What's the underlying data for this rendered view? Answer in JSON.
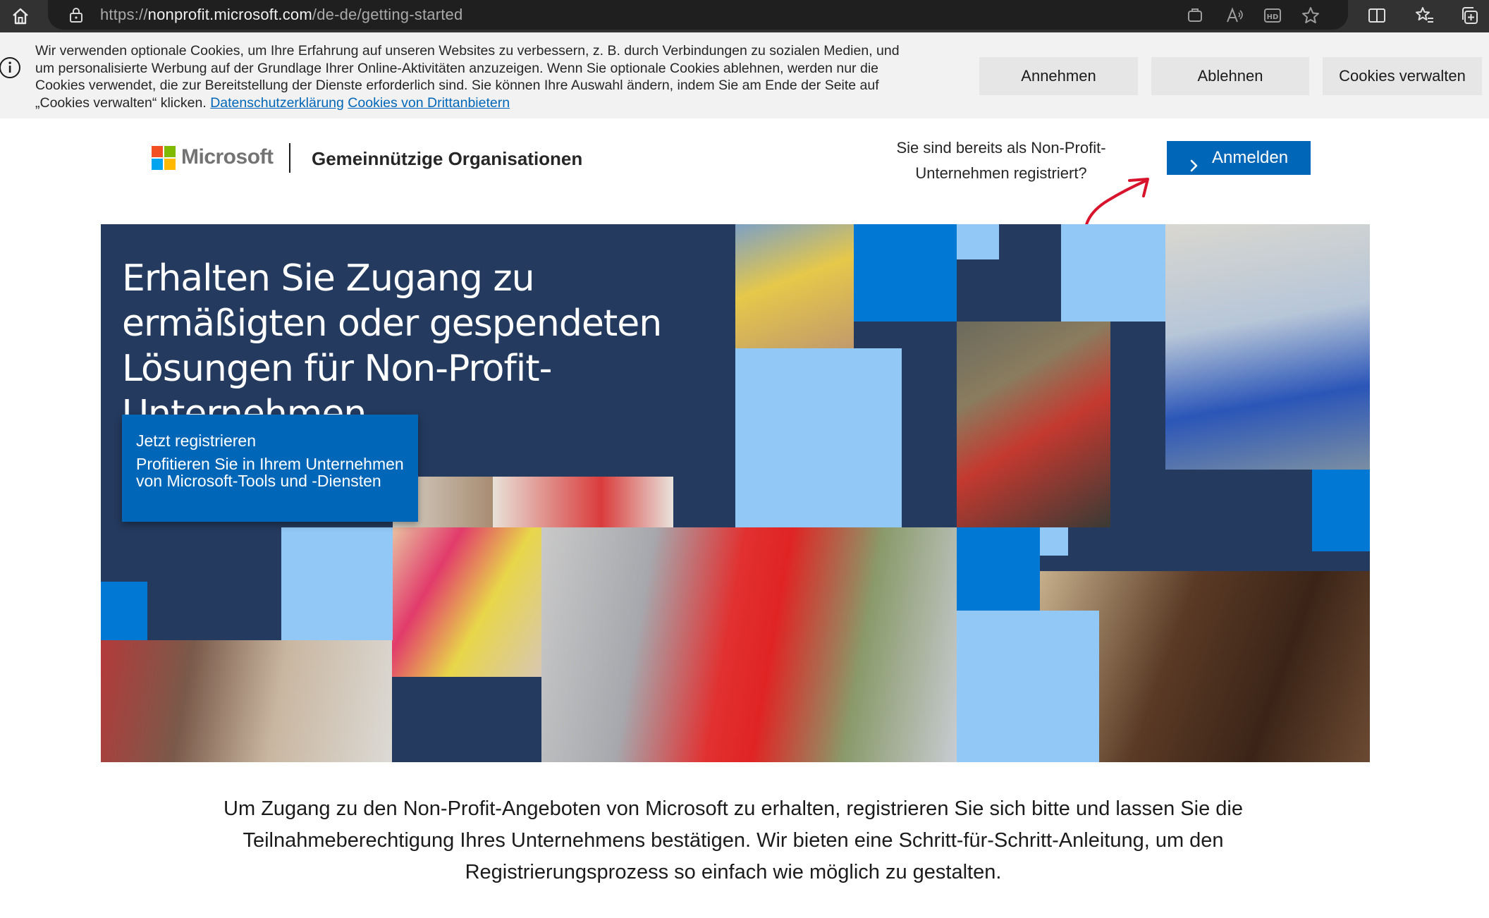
{
  "browser": {
    "url_scheme": "https://",
    "url_host": "nonprofit.microsoft.com",
    "url_path": "/de-de/getting-started",
    "icons": [
      "home-icon",
      "lock-icon",
      "extensions-icon",
      "read-aloud-icon",
      "hd-icon",
      "favorite-star-icon",
      "split-screen-icon",
      "favorites-icon",
      "collections-icon"
    ]
  },
  "cookie_banner": {
    "text": "Wir verwenden optionale Cookies, um Ihre Erfahrung auf unseren Websites zu verbessern, z. B. durch Verbindungen zu sozialen Medien, und um personalisierte Werbung auf der Grundlage Ihrer Online-Aktivitäten anzuzeigen. Wenn Sie optionale Cookies ablehnen, werden nur die Cookies verwendet, die zur Bereitstellung der Dienste erforderlich sind. Sie können Ihre Auswahl ändern, indem Sie am Ende der Seite auf „Cookies verwalten“ klicken.",
    "privacy_link": "Datenschutzerklärung",
    "third_party_link": "Cookies von Drittanbietern",
    "accept_label": "Annehmen",
    "decline_label": "Ablehnen",
    "manage_label": "Cookies verwalten"
  },
  "header": {
    "brand": "Microsoft",
    "site_title": "Gemeinnützige Organisationen",
    "already_registered": "Sie sind bereits als Non-Profit-Unternehmen registriert?",
    "signin_label": "Anmelden"
  },
  "hero": {
    "title": "Erhalten Sie Zugang zu ermäßigten oder gespendeten Lösungen für Non-Profit-Unternehmen",
    "cta_heading": "Jetzt registrieren",
    "cta_subtext": "Profitieren Sie in Ihrem Unternehmen von Microsoft-Tools und -Diensten"
  },
  "intro_text": "Um Zugang zu den Non-Profit-Angeboten von Microsoft zu erhalten, registrieren Sie sich bitte und lassen Sie die Teilnahmeberechtigung Ihres Unternehmens bestätigen. Wir bieten eine Schritt-für-Schritt-Anleitung, um den Registrierungsprozess so einfach wie möglich zu gestalten.",
  "colors": {
    "brand_blue": "#0067b8",
    "hero_navy": "#243a5e",
    "tile_blue": "#0078d4",
    "tile_light": "#91c8f6"
  }
}
